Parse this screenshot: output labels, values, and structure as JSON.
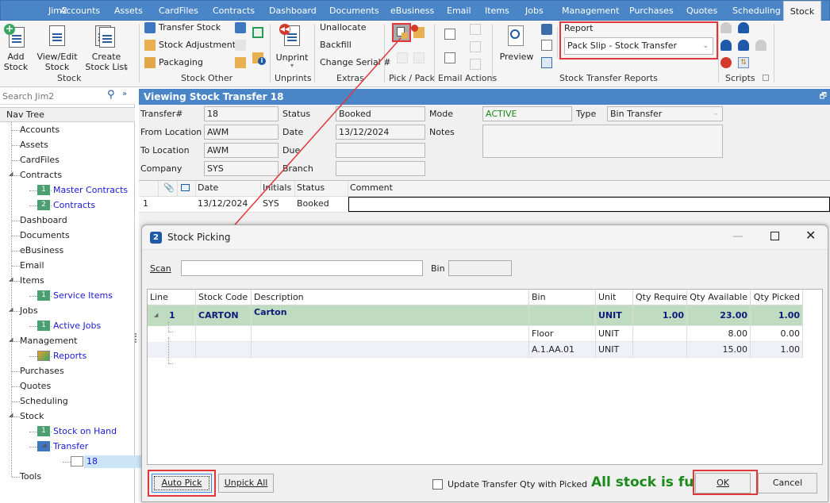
{
  "app": {
    "name": "Jim2"
  },
  "top_tabs": [
    "Accounts",
    "Assets",
    "CardFiles",
    "Contracts",
    "Dashboard",
    "Documents",
    "eBusiness",
    "Email",
    "Items",
    "Jobs",
    "Management",
    "Purchases",
    "Quotes",
    "Scheduling",
    "Stock"
  ],
  "active_tab": "Stock",
  "ribbon": {
    "stock_group": {
      "label": "Stock",
      "add": "Add\nStock",
      "view_edit": "View/Edit\nStock",
      "create_list": "Create\nStock List"
    },
    "stock_other": {
      "label": "Stock Other",
      "transfer_stock": "Transfer Stock",
      "stock_adjustments": "Stock Adjustments",
      "packaging": "Packaging"
    },
    "unprints": {
      "label": "Unprints",
      "unprint": "Unprint"
    },
    "extras": {
      "label": "Extras",
      "unallocate": "Unallocate",
      "backfill": "Backfill",
      "change_serial": "Change Serial #"
    },
    "pick_pack": {
      "label": "Pick / Pack"
    },
    "email_actions": {
      "label": "Email Actions"
    },
    "reports": {
      "label": "Stock Transfer Reports",
      "preview": "Preview",
      "report_label": "Report",
      "report_value": "Pack Slip - Stock Transfer"
    },
    "scripts": {
      "label": "Scripts"
    }
  },
  "sidebar": {
    "search_placeholder": "Search Jim2",
    "nav_header": "Nav Tree",
    "items": [
      {
        "label": "Accounts",
        "level": 0
      },
      {
        "label": "Assets",
        "level": 0
      },
      {
        "label": "CardFiles",
        "level": 0
      },
      {
        "label": "Contracts",
        "level": 0,
        "expanded": true
      },
      {
        "label": "Master Contracts",
        "level": 1,
        "link": true
      },
      {
        "label": "Contracts",
        "level": 1,
        "link": true
      },
      {
        "label": "Dashboard",
        "level": 0
      },
      {
        "label": "Documents",
        "level": 0
      },
      {
        "label": "eBusiness",
        "level": 0
      },
      {
        "label": "Email",
        "level": 0
      },
      {
        "label": "Items",
        "level": 0,
        "expanded": true
      },
      {
        "label": "Service Items",
        "level": 1,
        "link": true
      },
      {
        "label": "Jobs",
        "level": 0,
        "expanded": true
      },
      {
        "label": "Active Jobs",
        "level": 1,
        "link": true
      },
      {
        "label": "Management",
        "level": 0,
        "expanded": true
      },
      {
        "label": "Reports",
        "level": 1,
        "link": true
      },
      {
        "label": "Purchases",
        "level": 0
      },
      {
        "label": "Quotes",
        "level": 0
      },
      {
        "label": "Scheduling",
        "level": 0
      },
      {
        "label": "Stock",
        "level": 0,
        "expanded": true
      },
      {
        "label": "Stock on Hand",
        "level": 1,
        "link": true
      },
      {
        "label": "Transfer",
        "level": 1,
        "link": true,
        "expanded": true
      },
      {
        "label": "18",
        "level": 2,
        "link": true,
        "selected": true
      },
      {
        "label": "Tools",
        "level": 0
      }
    ]
  },
  "main": {
    "title": "Viewing Stock Transfer 18",
    "fields": {
      "transfer_no_label": "Transfer#",
      "transfer_no": "18",
      "from_location_label": "From Location",
      "from_location": "AWM",
      "to_location_label": "To Location",
      "to_location": "AWM",
      "company_label": "Company",
      "company": "SYS",
      "status_label": "Status",
      "status": "Booked",
      "date_label": "Date",
      "date": "13/12/2024",
      "due_label": "Due",
      "due": "",
      "branch_label": "Branch",
      "branch": "",
      "mode_label": "Mode",
      "mode": "ACTIVE",
      "notes_label": "Notes",
      "notes": "",
      "type_label": "Type",
      "type": "Bin Transfer"
    },
    "history": {
      "columns": [
        "Date",
        "Initials",
        "Status",
        "Comment"
      ],
      "rows": [
        {
          "no": "1",
          "date": "13/12/2024",
          "initials": "SYS",
          "status": "Booked",
          "comment": ""
        }
      ]
    }
  },
  "dialog": {
    "title": "Stock Picking",
    "scan_label": "Scan",
    "scan_value": "",
    "bin_label": "Bin",
    "bin_value": "",
    "columns": [
      "Line",
      "Stock Code",
      "Description",
      "Bin",
      "Unit",
      "Qty Required",
      "Qty Available",
      "Qty Picked"
    ],
    "rows": [
      {
        "line": "1",
        "stock_code": "CARTON",
        "description": "Carton",
        "bin": "",
        "unit": "UNIT",
        "qty_required": "1.00",
        "qty_available": "23.00",
        "qty_picked": "1.00"
      },
      {
        "line": "",
        "stock_code": "",
        "description": "",
        "bin": "Floor",
        "unit": "UNIT",
        "qty_required": "",
        "qty_available": "8.00",
        "qty_picked": "0.00"
      },
      {
        "line": "",
        "stock_code": "",
        "description": "",
        "bin": "A.1.AA.01",
        "unit": "UNIT",
        "qty_required": "",
        "qty_available": "15.00",
        "qty_picked": "1.00"
      }
    ],
    "auto_pick": "Auto Pick",
    "unpick_all": "Unpick All",
    "update_checkbox_label": "Update Transfer Qty with Picked",
    "update_checked": false,
    "status_message": "All stock is fu",
    "ok": "OK",
    "cancel": "Cancel"
  },
  "colors": {
    "accent": "#4a86c7",
    "highlight_row": "#c0dcc0",
    "status_green": "#1a8a1a",
    "annotation_red": "#e0373d"
  }
}
